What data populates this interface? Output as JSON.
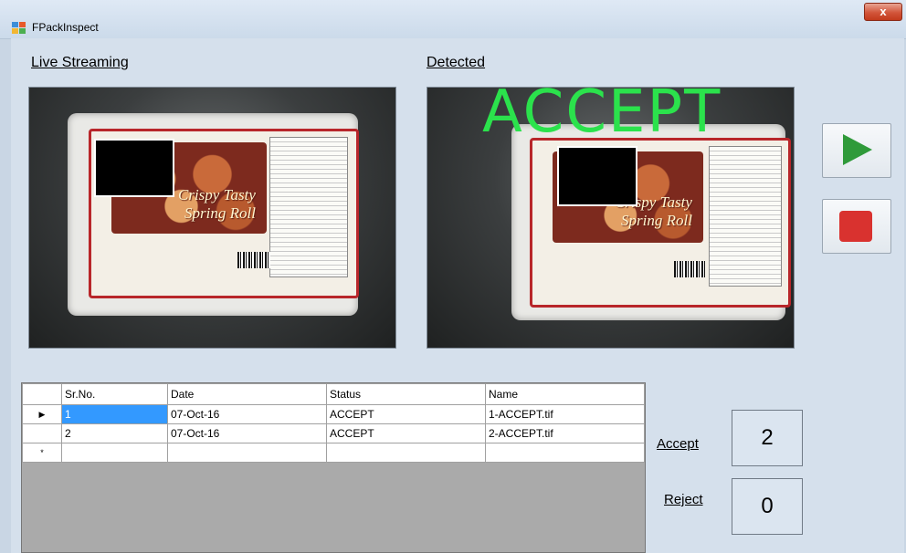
{
  "window": {
    "title": "FPackInspect",
    "close_glyph": "x"
  },
  "live": {
    "label": "Live Streaming"
  },
  "detected": {
    "label": "Detected",
    "overlay_text": "ACCEPT"
  },
  "product": {
    "brand_line1": "Crispy Tasty",
    "brand_line2": "Spring Roll"
  },
  "controls": {
    "play_icon": "play-icon",
    "stop_icon": "stop-icon"
  },
  "grid": {
    "columns": [
      "Sr.No.",
      "Date",
      "Status",
      "Name"
    ],
    "rows": [
      {
        "marker": "▶",
        "sr": "1",
        "date": "07-Oct-16",
        "status": "ACCEPT",
        "name": "1-ACCEPT.tif"
      },
      {
        "marker": "",
        "sr": "2",
        "date": "07-Oct-16",
        "status": "ACCEPT",
        "name": "2-ACCEPT.tif"
      }
    ],
    "new_row_marker": "*"
  },
  "stats": {
    "accept_label": "Accept",
    "accept_count": "2",
    "reject_label": "Reject",
    "reject_count": "0"
  },
  "colors": {
    "accept_overlay": "#2be24c",
    "play": "#2f9a3a",
    "stop": "#d9322f",
    "selection": "#3399ff"
  }
}
